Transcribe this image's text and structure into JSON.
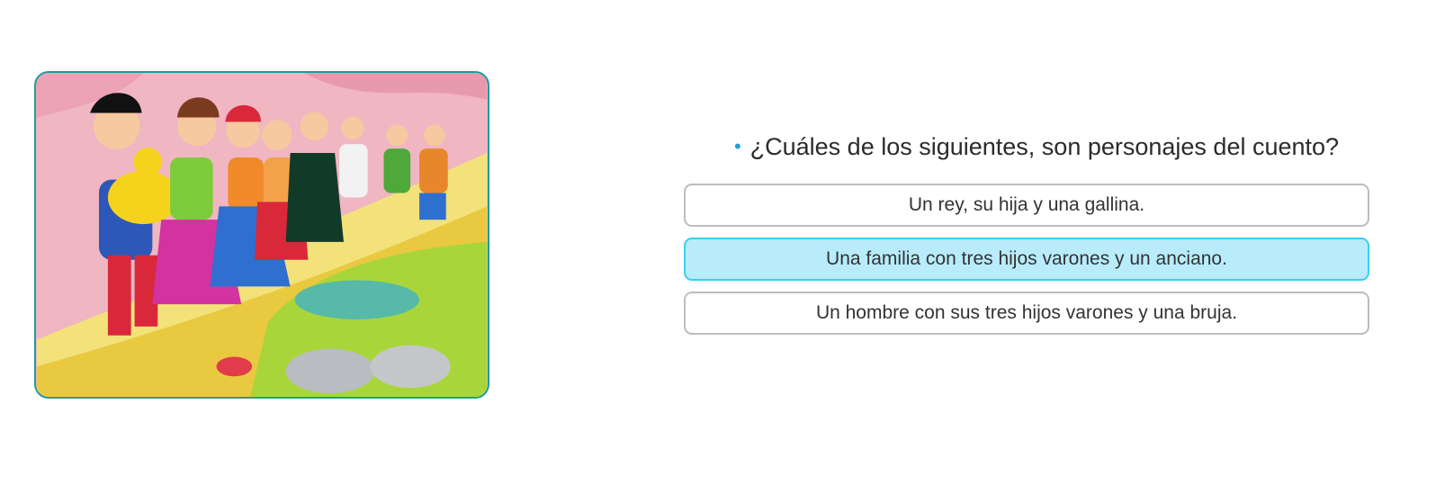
{
  "illustration": {
    "icon": "story-illustration"
  },
  "quiz": {
    "question": "¿Cuáles de los siguientes, son personajes del cuento?",
    "options": [
      {
        "label": "Un rey, su hija y una gallina.",
        "selected": false
      },
      {
        "label": "Una familia con tres hijos varones y un anciano.",
        "selected": true
      },
      {
        "label": "Un hombre con sus tres hijos varones y una bruja.",
        "selected": false
      }
    ]
  },
  "colors": {
    "accent": "#1ea0d6",
    "selected_bg": "#b8ecfb",
    "selected_border": "#3ccdf0",
    "frame": "#1e9aa3"
  }
}
